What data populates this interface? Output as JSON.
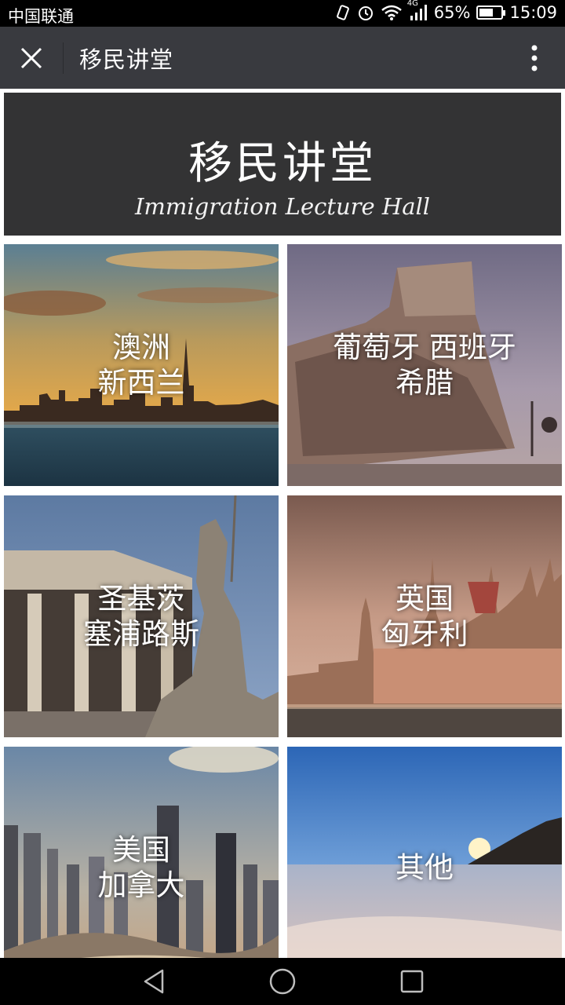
{
  "status": {
    "carrier": "中国联通",
    "network": "4G",
    "battery": "65%",
    "battery_level": 0.65,
    "time": "15:09"
  },
  "header": {
    "title": "移民讲堂"
  },
  "banner": {
    "title": "移民讲堂",
    "subtitle": "Immigration Lecture Hall"
  },
  "tiles": [
    {
      "line1": "澳洲",
      "line2": "新西兰",
      "scene": "city-skyline-sunset"
    },
    {
      "line1": "葡萄牙 西班牙",
      "line2": "希腊",
      "scene": "monument-of-discoveries"
    },
    {
      "line1": "圣基茨",
      "line2": "塞浦路斯",
      "scene": "greek-columns-statue"
    },
    {
      "line1": "英国",
      "line2": "匈牙利",
      "scene": "parliament-building"
    },
    {
      "line1": "美国",
      "line2": "加拿大",
      "scene": "skyscrapers"
    },
    {
      "line1": "其他",
      "line2": "",
      "scene": "beach-sunset"
    }
  ],
  "colors": {
    "titlebar": "#393a3f",
    "banner": "#333334",
    "statusbar": "#000000"
  }
}
